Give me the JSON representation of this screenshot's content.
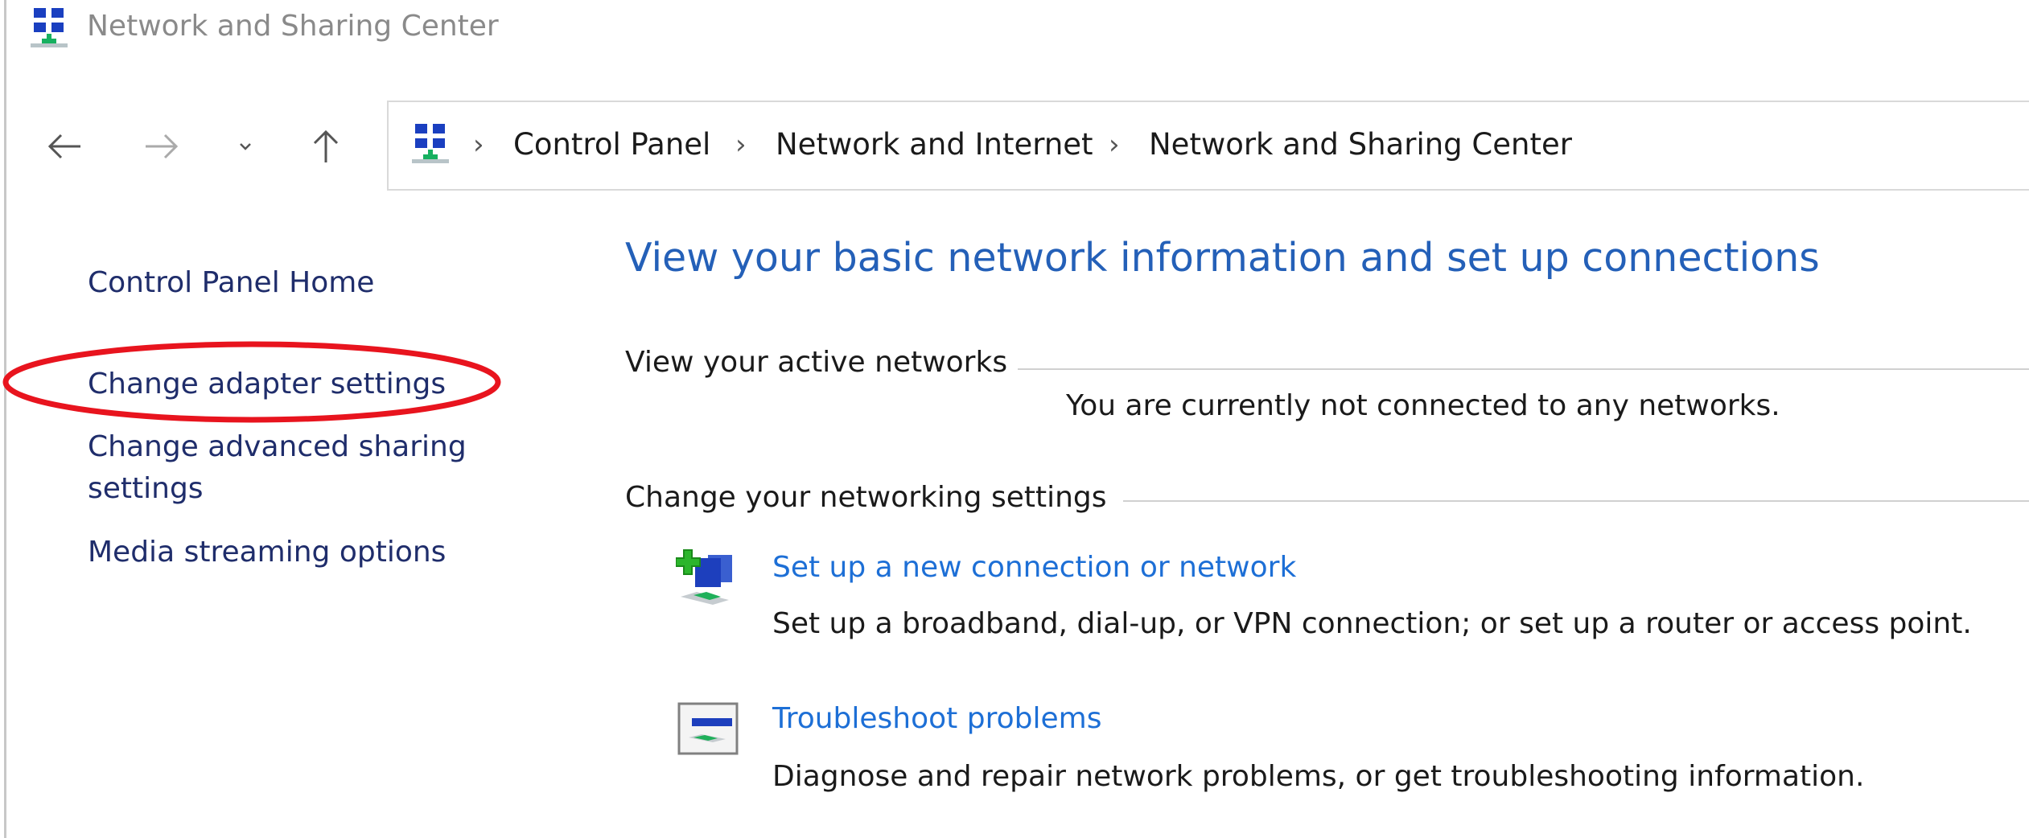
{
  "window": {
    "title": "Network and Sharing Center",
    "icon": "network-icon"
  },
  "nav": {
    "back": "arrow-left-icon",
    "forward": "arrow-right-icon",
    "recent": "chevron-down-icon",
    "up": "arrow-up-icon"
  },
  "breadcrumb": [
    "Control Panel",
    "Network and Internet",
    "Network and Sharing Center"
  ],
  "sidebar": {
    "items": [
      {
        "label": "Control Panel Home"
      },
      {
        "label": "Change adapter settings",
        "highlighted": true
      },
      {
        "label": "Change advanced sharing settings"
      },
      {
        "label": "Media streaming options"
      }
    ],
    "highlight_color": "#e8141e"
  },
  "main": {
    "heading": "View your basic network information and set up connections",
    "active_networks": {
      "title": "View your active networks",
      "status": "You are currently not connected to any networks."
    },
    "settings": {
      "title": "Change your networking settings",
      "items": [
        {
          "label": "Set up a new connection or network",
          "description": "Set up a broadband, dial-up, or VPN connection; or set up a router or access point.",
          "icon": "new-connection-icon"
        },
        {
          "label": "Troubleshoot problems",
          "description": "Diagnose and repair network problems, or get troubleshooting information.",
          "icon": "troubleshoot-icon"
        }
      ]
    }
  },
  "colors": {
    "heading": "#2460b8",
    "link": "#1d6fd6",
    "sidebar_link": "#1f2d6b"
  }
}
